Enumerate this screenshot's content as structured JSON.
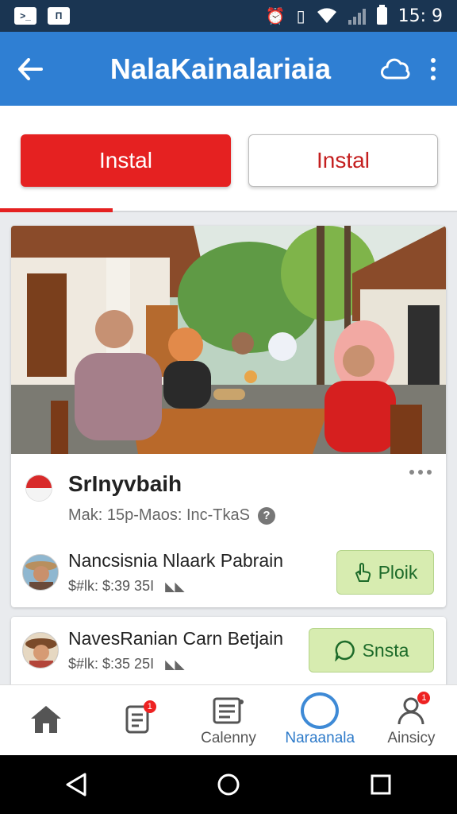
{
  "status_bar": {
    "left_icons": [
      "terminal-icon",
      "window-icon"
    ],
    "right_icons": [
      "alarm-icon",
      "vibrate-icon",
      "wifi-icon",
      "signal-icon",
      "battery-icon"
    ],
    "time": "15: 9",
    "box1": ">_",
    "box2": "П"
  },
  "app_bar": {
    "title": "NalaKainalariaia",
    "color": "#2f7fd3"
  },
  "actions": {
    "primary_label": "Instal",
    "secondary_label": "Instal",
    "accent": "#e52121"
  },
  "card": {
    "title": "SrInyvbaih",
    "subtitle": "Mak: 15p-Maos: Inc-TkaS",
    "rows": [
      {
        "name": "Nancsisnia Nlaark Pabrain",
        "meta": "$#lk: $:39 35I",
        "button": "Ploik"
      }
    ]
  },
  "card2": {
    "name": "NavesRanian Carn Betjain",
    "meta": "$#lk: $:35 25I",
    "button": "Snsta"
  },
  "bottom_nav": [
    {
      "label": "",
      "icon": "home-icon"
    },
    {
      "label": "",
      "icon": "receipt-icon",
      "badge": "1"
    },
    {
      "label": "Calenny",
      "icon": "list-icon"
    },
    {
      "label": "Naraanala",
      "icon": "cloud-icon"
    },
    {
      "label": "Ainsicy",
      "icon": "person-icon",
      "badge": "1"
    }
  ]
}
